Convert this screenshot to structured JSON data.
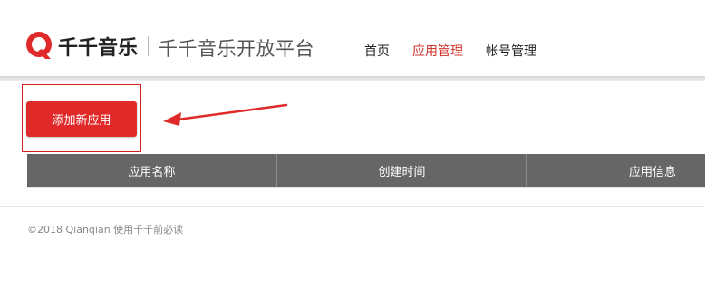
{
  "header": {
    "logo_text": "千千音乐",
    "platform_title": "千千音乐开放平台",
    "brand_color": "#e02a2a"
  },
  "nav": {
    "items": [
      {
        "label": "首页",
        "active": false
      },
      {
        "label": "应用管理",
        "active": true
      },
      {
        "label": "帐号管理",
        "active": false
      }
    ],
    "active_color": "#d0342c"
  },
  "main": {
    "add_button_label": "添加新应用",
    "table": {
      "columns": [
        "应用名称",
        "创建时间",
        "应用信息"
      ],
      "rows": []
    }
  },
  "footer": {
    "text": "©2018 Qianqian 使用千千前必读"
  }
}
